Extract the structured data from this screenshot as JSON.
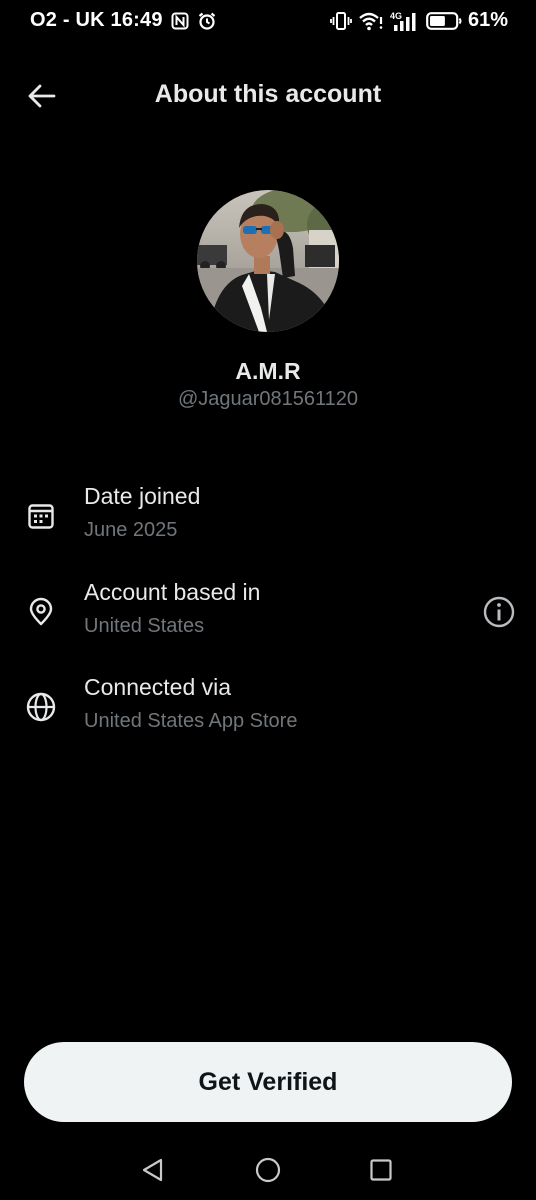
{
  "status_bar": {
    "carrier_time": "O2 - UK 16:49",
    "battery_percent": "61%",
    "battery_level": 0.61,
    "icons": [
      "nfc-icon",
      "alarm-icon",
      "vibrate-icon",
      "wifi-icon",
      "signal-4g-icon",
      "battery-icon"
    ],
    "network_label": "4G"
  },
  "header": {
    "title": "About this account",
    "back_icon": "arrow-left-icon"
  },
  "profile": {
    "display_name": "A.M.R",
    "handle": "@Jaguar081561120"
  },
  "info": [
    {
      "title": "Date joined",
      "value": "June 2025",
      "icon": "calendar-icon"
    },
    {
      "title": "Account based in",
      "value": "United States",
      "icon": "location-pin-icon",
      "action_icon": "info-icon"
    },
    {
      "title": "Connected via",
      "value": "United States App Store",
      "icon": "globe-icon"
    }
  ],
  "actions": {
    "verify_label": "Get Verified"
  },
  "nav_bar": {
    "icons": [
      "back-triangle-icon",
      "home-circle-icon",
      "recents-square-icon"
    ]
  },
  "colors": {
    "background": "#000000",
    "primary_text": "#e7e9ea",
    "secondary_text": "#71767b",
    "button_bg": "#eff3f4",
    "button_text": "#0f1419"
  }
}
